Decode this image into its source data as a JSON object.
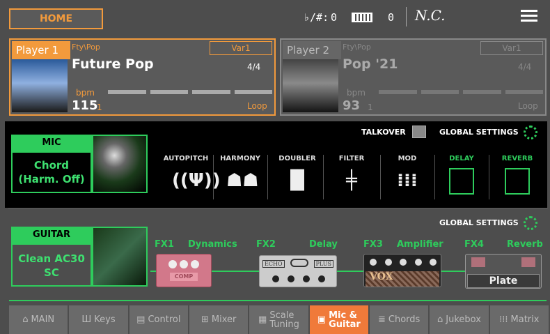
{
  "topbar": {
    "home_label": "HOME",
    "transpose_label": "♭/#:",
    "transpose_value": "0",
    "octave_value": "0",
    "chord": "N.C."
  },
  "player1": {
    "name": "Player 1",
    "category": "Fty\\Pop",
    "variation": "Var1",
    "style": "Future Pop",
    "meter": "4/4",
    "bpm_label": "bpm",
    "bpm": "115",
    "beat": "1",
    "mode": "Loop"
  },
  "player2": {
    "name": "Player 2",
    "category": "Fty\\Pop",
    "variation": "Var1",
    "style": "Pop '21",
    "meter": "4/4",
    "bpm_label": "bpm",
    "bpm": "93",
    "beat": "1",
    "mode": "Loop"
  },
  "mic": {
    "title": "MIC",
    "preset_line1": "Chord",
    "preset_line2": "(Harm. Off)",
    "talkover_label": "TALKOVER",
    "global_settings_label": "GLOBAL SETTINGS",
    "effects": [
      {
        "label": "AUTOPITCH",
        "icon": "tuning-fork-icon",
        "active": false
      },
      {
        "label": "HARMONY",
        "icon": "harmony-faces-icon",
        "active": false
      },
      {
        "label": "DOUBLER",
        "icon": "doubler-icon",
        "active": false
      },
      {
        "label": "FILTER",
        "icon": "filter-icon",
        "active": false
      },
      {
        "label": "MOD",
        "icon": "waveform-icon",
        "active": false
      },
      {
        "label": "DELAY",
        "icon": "delay-planes-icon",
        "active": true
      },
      {
        "label": "REVERB",
        "icon": "reverb-cube-icon",
        "active": true
      }
    ]
  },
  "guitar": {
    "title": "GUITAR",
    "preset_line1": "Clean AC30",
    "preset_line2": "SC",
    "global_settings_label": "GLOBAL SETTINGS",
    "fx": [
      {
        "slot": "FX1",
        "name": "Dynamics",
        "pedal_label": "COMP"
      },
      {
        "slot": "FX2",
        "name": "Delay",
        "pedal_left": "ECHO",
        "pedal_right": "PLUS"
      },
      {
        "slot": "FX3",
        "name": "Amplifier",
        "pedal_label": "VOX"
      },
      {
        "slot": "FX4",
        "name": "Reverb",
        "pedal_label": "Plate"
      }
    ]
  },
  "tabs": [
    {
      "line1": "MAIN",
      "line2": "",
      "icon": "home-icon"
    },
    {
      "line1": "Keys",
      "line2": "",
      "icon": "keys-icon"
    },
    {
      "line1": "Control",
      "line2": "",
      "icon": "control-icon"
    },
    {
      "line1": "Mixer",
      "line2": "",
      "icon": "mixer-icon"
    },
    {
      "line1": "Scale",
      "line2": "Tuning",
      "icon": "scale-icon"
    },
    {
      "line1": "Mic &",
      "line2": "Guitar",
      "icon": "mic-icon",
      "active": true
    },
    {
      "line1": "Chords",
      "line2": "",
      "icon": "chords-icon"
    },
    {
      "line1": "Jukebox",
      "line2": "",
      "icon": "jukebox-icon"
    },
    {
      "line1": "Matrix",
      "line2": "",
      "icon": "matrix-icon"
    }
  ],
  "colors": {
    "accent_orange": "#f29a3c",
    "accent_green": "#2ecc5c",
    "background": "#4d4d4d"
  }
}
